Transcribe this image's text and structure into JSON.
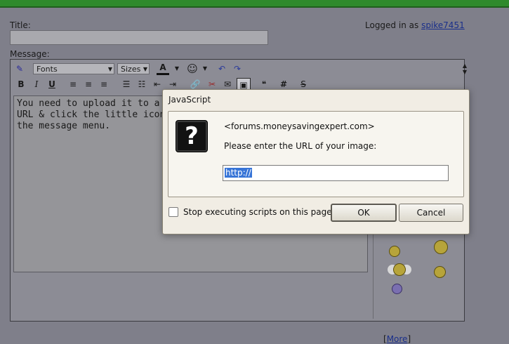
{
  "form": {
    "title_label": "Title:",
    "message_label": "Message:",
    "logged_in_text": "Logged in as",
    "username": "spike7451"
  },
  "toolbar": {
    "fonts": "Fonts",
    "sizes": "Sizes",
    "bold": "B",
    "italic": "I",
    "underline": "U",
    "hash": "#"
  },
  "editor": {
    "text": "You need to upload it to a site\nURL & click the little icon betwe\nthe message menu."
  },
  "smilies": {
    "more_label": "More"
  },
  "dialog": {
    "title": "JavaScript",
    "origin": "<forums.moneysavingexpert.com>",
    "prompt": "Please enter the URL of your image:",
    "input_value": "http://",
    "checkbox_label": "Stop executing scripts on this page",
    "ok_label": "OK",
    "cancel_label": "Cancel"
  },
  "colors": {
    "topbar": "#2f8a2c",
    "link": "#1a2f8a",
    "selection": "#3875d7"
  }
}
